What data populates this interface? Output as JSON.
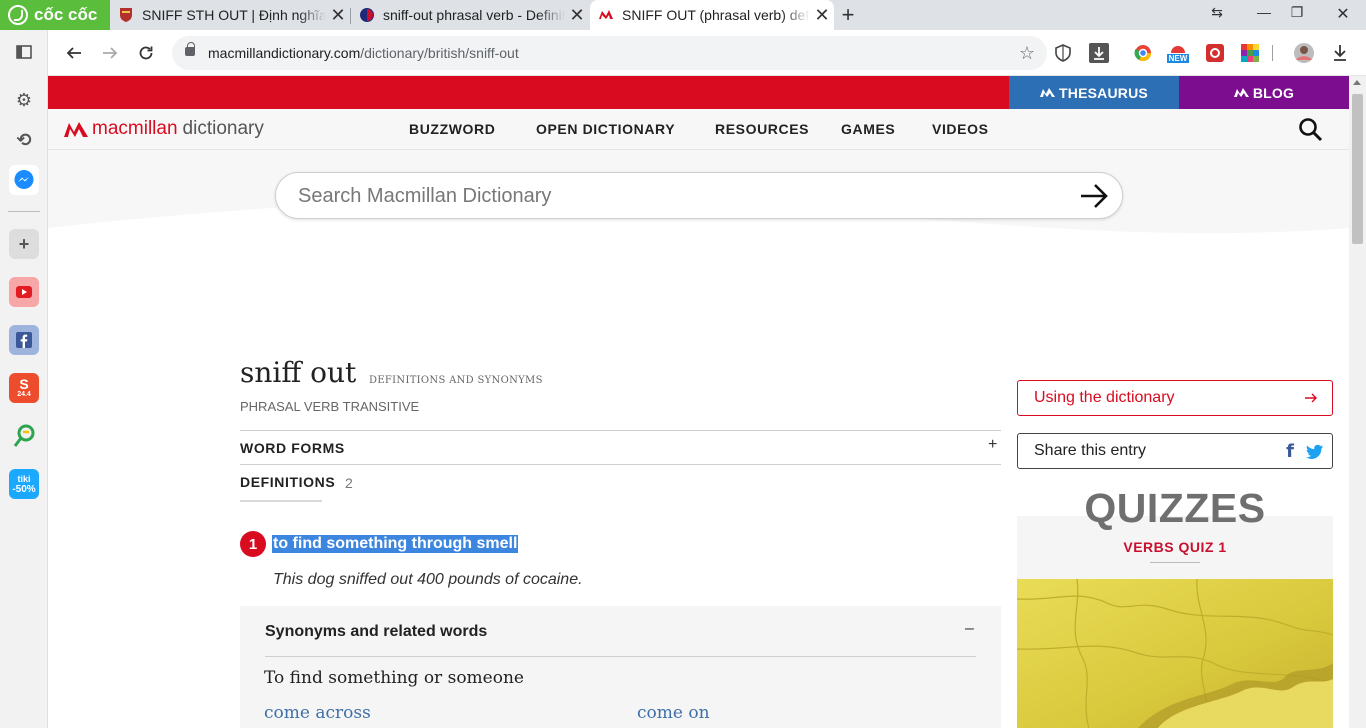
{
  "browser": {
    "brand": "cốc cốc",
    "tabs": [
      {
        "title": "SNIFF STH OUT | Định nghĩa trong Từ điển tiếng Anh Cambridge"
      },
      {
        "title": "sniff-out phrasal verb - Definition"
      },
      {
        "title": "SNIFF OUT (phrasal verb) definition"
      }
    ],
    "url_host": "macmillandictionary.com",
    "url_path": "/dictionary/british/sniff-out",
    "sidebar_badges": {
      "shopee": "24.4",
      "tiki": "tiki",
      "tiki_discount": "-50%"
    },
    "extension_badge": "NEW"
  },
  "site": {
    "topbar": {
      "thesaurus": "THESAURUS",
      "blog": "BLOG"
    },
    "logo": {
      "brand": "macmillan",
      "suffix": "dictionary"
    },
    "nav": [
      "BUZZWORD",
      "OPEN DICTIONARY",
      "RESOURCES",
      "GAMES",
      "VIDEOS"
    ],
    "search_placeholder": "Search Macmillan Dictionary"
  },
  "entry": {
    "headword": "sniff out",
    "subtitle": "DEFINITIONS AND SYNONYMS",
    "pos": "PHRASAL VERB",
    "grammar": "TRANSITIVE",
    "word_forms": "WORD FORMS",
    "word_forms_toggle": "+",
    "definitions_label": "DEFINITIONS",
    "definitions_count": "2",
    "sense_number": "1",
    "definition": "to find something through smell",
    "example": "This dog sniffed out 400 pounds of cocaine.",
    "synonyms": {
      "title": "Synonyms and related words",
      "toggle": "–",
      "sense": "To find something or someone",
      "links": [
        "come across",
        "come on"
      ]
    }
  },
  "sidebar_right": {
    "using": "Using the dictionary",
    "share": "Share this entry",
    "quizzes_title": "QUIZZES",
    "quiz_name": "VERBS QUIZ 1"
  },
  "colors": {
    "brand_red": "#d90b20",
    "thesaurus_blue": "#2d6fb4",
    "blog_purple": "#7c0d8f",
    "highlight": "#3d86e0"
  }
}
